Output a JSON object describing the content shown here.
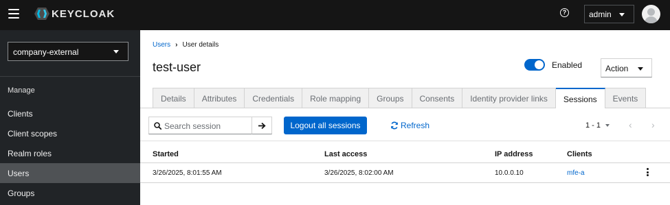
{
  "topbar": {
    "logo_text": "KEYCLOAK",
    "user_menu_label": "admin"
  },
  "sidebar": {
    "realm": "company-external",
    "section_title": "Manage",
    "items": [
      {
        "label": "Clients"
      },
      {
        "label": "Client scopes"
      },
      {
        "label": "Realm roles"
      },
      {
        "label": "Users"
      },
      {
        "label": "Groups"
      }
    ],
    "active_item": "Users"
  },
  "breadcrumb": {
    "parent": "Users",
    "current": "User details"
  },
  "page": {
    "title": "test-user",
    "enabled_label": "Enabled",
    "enabled": true,
    "action_label": "Action"
  },
  "tabs": [
    {
      "label": "Details"
    },
    {
      "label": "Attributes"
    },
    {
      "label": "Credentials"
    },
    {
      "label": "Role mapping"
    },
    {
      "label": "Groups"
    },
    {
      "label": "Consents"
    },
    {
      "label": "Identity provider links"
    },
    {
      "label": "Sessions"
    },
    {
      "label": "Events"
    }
  ],
  "active_tab": "Sessions",
  "toolbar": {
    "search_placeholder": "Search session",
    "logout_all_label": "Logout all sessions",
    "refresh_label": "Refresh",
    "pagination": "1 - 1"
  },
  "table": {
    "columns": [
      "Started",
      "Last access",
      "IP address",
      "Clients"
    ],
    "rows": [
      {
        "started": "3/26/2025, 8:01:55 AM",
        "last_access": "3/26/2025, 8:02:00 AM",
        "ip_address": "10.0.0.10",
        "clients": "mfe-a"
      }
    ]
  },
  "colors": {
    "accent": "#0066cc",
    "masthead": "#151515",
    "sidebar": "#212427"
  }
}
